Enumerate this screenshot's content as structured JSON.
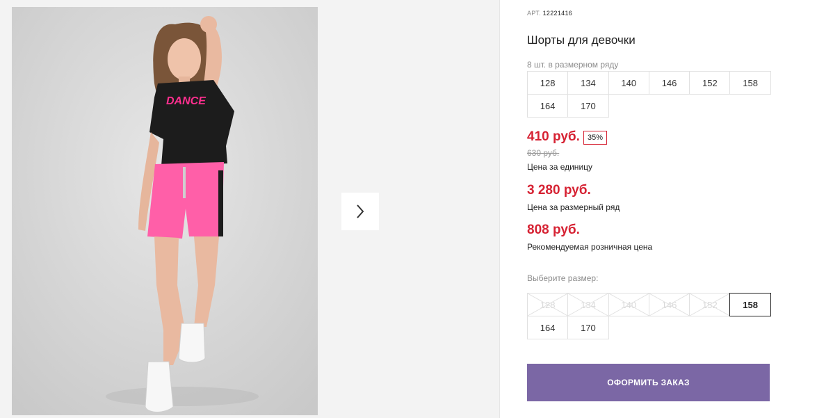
{
  "gallery": {
    "photo_print_text": "DANCE",
    "next_icon": "chevron-right-icon"
  },
  "product": {
    "sku_label": "АРТ.",
    "sku_value": "12221416",
    "title": "Шорты для девочки",
    "pack_note": "8 шт. в размерном ряду",
    "pack_sizes": [
      "128",
      "134",
      "140",
      "146",
      "152",
      "158",
      "164",
      "170"
    ],
    "unit_price": "410 руб.",
    "discount": "35%",
    "old_price": "630 руб.",
    "unit_price_label": "Цена за единицу",
    "pack_price": "3 280 руб.",
    "pack_price_label": "Цена за размерный ряд",
    "rrp_price": "808 руб.",
    "rrp_label": "Рекомендуемая розничная цена",
    "choose_size_label": "Выберите размер:",
    "sizes": [
      {
        "label": "128",
        "available": false,
        "selected": false
      },
      {
        "label": "134",
        "available": false,
        "selected": false
      },
      {
        "label": "140",
        "available": false,
        "selected": false
      },
      {
        "label": "146",
        "available": false,
        "selected": false
      },
      {
        "label": "152",
        "available": false,
        "selected": false
      },
      {
        "label": "158",
        "available": true,
        "selected": true
      },
      {
        "label": "164",
        "available": true,
        "selected": false
      },
      {
        "label": "170",
        "available": true,
        "selected": false
      }
    ],
    "order_button": "ОФОРМИТЬ ЗАКАЗ"
  },
  "colors": {
    "accent_price": "#d62233",
    "order_button": "#7b67a5",
    "gallery_bg": "#f3f3f3"
  }
}
